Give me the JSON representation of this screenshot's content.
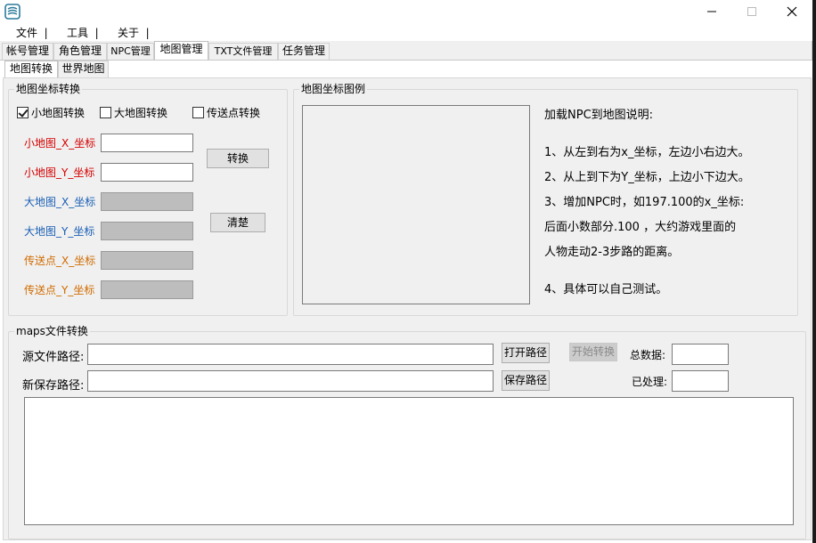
{
  "menu": {
    "items": [
      "文件",
      "工具",
      "关于"
    ],
    "separator": "|"
  },
  "tabs": [
    "帐号管理",
    "角色管理",
    "NPC管理",
    "地图管理",
    "TXT文件管理",
    "任务管理"
  ],
  "subtabs": [
    "地图转换",
    "世界地图"
  ],
  "coord_group": {
    "title": "地图坐标转换",
    "checkboxes": [
      {
        "label": "小地图转换",
        "checked": true
      },
      {
        "label": "大地图转换",
        "checked": false
      },
      {
        "label": "传送点转换",
        "checked": false
      }
    ],
    "fields": [
      {
        "label": "小地图_X_坐标",
        "value": ""
      },
      {
        "label": "小地图_Y_坐标",
        "value": ""
      },
      {
        "label": "大地图_X_坐标",
        "value": ""
      },
      {
        "label": "大地图_Y_坐标",
        "value": ""
      },
      {
        "label": "传送点_X_坐标",
        "value": ""
      },
      {
        "label": "传送点_Y_坐标",
        "value": ""
      }
    ],
    "convert_button": "转换",
    "clear_button": "清楚"
  },
  "legend_group": {
    "title": "地图坐标图例",
    "heading": "加载NPC到地图说明:",
    "lines": [
      "1、从左到右为x_坐标，左边小右边大。",
      "2、从上到下为Y_坐标，上边小下边大。",
      "3、增加NPC时，如197.100的x_坐标:",
      "后面小数部分.100 ，大约游戏里面的",
      "人物走动2-3步路的距离。",
      "4、具体可以自己测试。"
    ]
  },
  "maps_group": {
    "title": "maps文件转换",
    "source_label": "源文件路径:",
    "source_value": "",
    "save_label": "新保存路径:",
    "save_value": "",
    "open_path_button": "打开路径",
    "save_path_button": "保存路径",
    "start_button": "开始转换",
    "total_label": "总数据:",
    "total_value": "",
    "processed_label": "已处理:",
    "processed_value": "",
    "log_text": ""
  },
  "colors": {
    "small_map": "#d40000",
    "big_map": "#1a5fb4",
    "teleport": "#d06b00"
  },
  "icons": {
    "app": "app-logo-icon",
    "minimize": "minimize-icon",
    "maximize": "maximize-icon",
    "close": "close-icon"
  }
}
